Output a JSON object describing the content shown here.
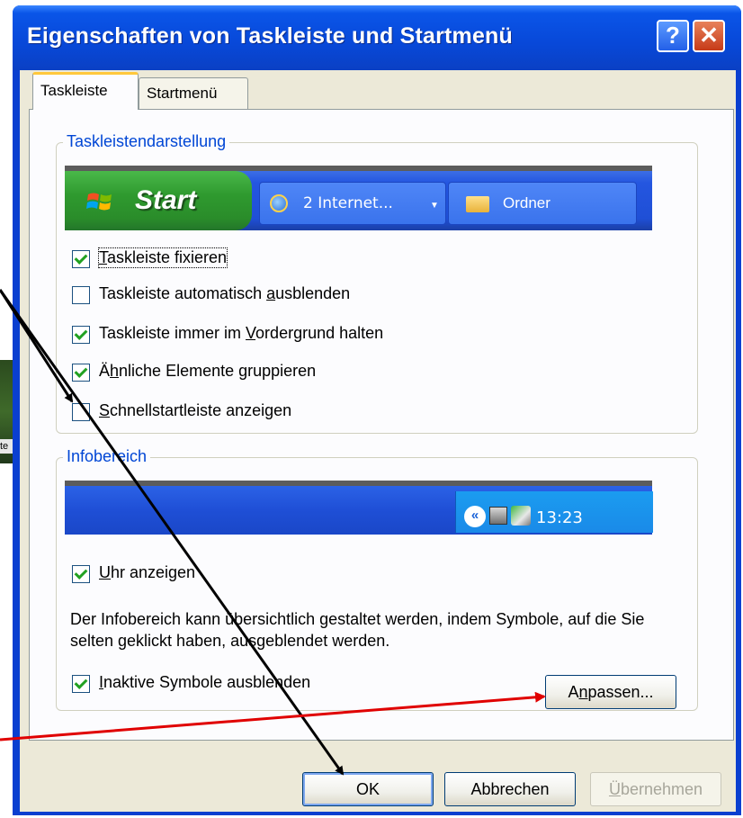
{
  "window": {
    "title": "Eigenschaften von Taskleiste und Startmenü",
    "help_label": "?",
    "close_label": "✕"
  },
  "background": {
    "thumb_label": "te"
  },
  "tabs": [
    {
      "label": "Taskleiste",
      "active": true
    },
    {
      "label": "Startmenü",
      "active": false
    }
  ],
  "group_taskbar": {
    "legend": "Taskleistendarstellung",
    "preview": {
      "start_label": "Start",
      "task_ie_label": "2 Internet...",
      "task_ordner_label": "Ordner"
    },
    "options": [
      {
        "pre": "",
        "key": "T",
        "post": "askleiste fixieren",
        "checked": true
      },
      {
        "pre": "Taskleiste automatisch ",
        "key": "a",
        "post": "usblenden",
        "checked": false
      },
      {
        "pre": "Taskleiste immer im ",
        "key": "V",
        "post": "ordergrund halten",
        "checked": true
      },
      {
        "pre": "Ä",
        "key": "h",
        "post": "nliche Elemente gruppieren",
        "checked": true
      },
      {
        "pre": "",
        "key": "S",
        "post": "chnellstartleiste anzeigen",
        "checked": false
      }
    ]
  },
  "group_tray": {
    "legend": "Infobereich",
    "preview": {
      "chevron": "«",
      "clock": "13:23"
    },
    "clock_option": {
      "pre": "",
      "key": "U",
      "post": "hr anzeigen",
      "checked": true
    },
    "info_text": "Der Infobereich kann übersichtlich gestaltet werden, indem Symbole, auf die Sie selten geklickt haben, ausgeblendet werden.",
    "inactive_option": {
      "pre": "",
      "key": "I",
      "post": "naktive Symbole ausblenden",
      "checked": true
    },
    "customize_button": {
      "pre": "A",
      "key": "n",
      "post": "passen..."
    }
  },
  "footer": {
    "ok_label": "OK",
    "cancel_label": "Abbrechen",
    "apply_pre": "",
    "apply_key": "Ü",
    "apply_post": "bernehmen"
  },
  "colors": {
    "title_blue": "#0a55e8",
    "legend_blue": "#0046d5",
    "arrow_black": "#000000",
    "arrow_red": "#e00000",
    "check_green": "#21a121"
  }
}
